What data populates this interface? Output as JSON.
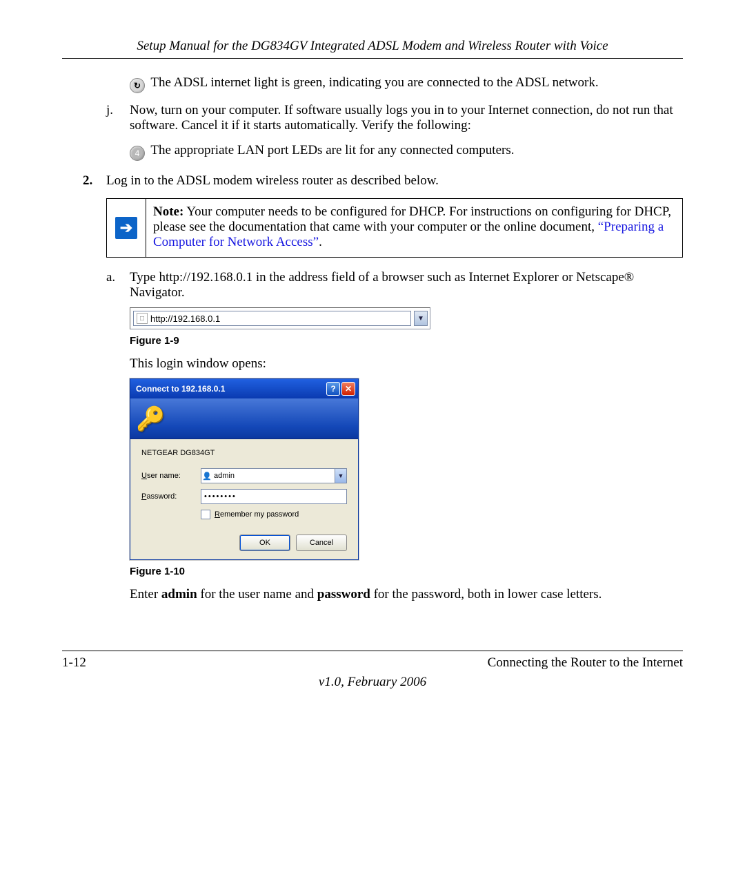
{
  "header": {
    "title": "Setup Manual for the DG834GV Integrated ADSL Modem and Wireless Router with Voice"
  },
  "body": {
    "i_line": "The ADSL internet light is green, indicating you are connected to the ADSL network.",
    "j_marker": "j.",
    "j_text": "Now, turn on your computer. If software usually logs you in to your Internet connection, do not run that software. Cancel it if it starts automatically. Verify the following:",
    "lan_badge": "4",
    "lan_text": "The appropriate LAN port LEDs are lit for any connected computers.",
    "step2_marker": "2.",
    "step2_text": "Log in to the ADSL modem wireless router as described below.",
    "note_label": "Note:",
    "note_text": " Your computer needs to be configured for DHCP. For instructions on configuring for DHCP, please see the documentation that came with your computer or the online document, ",
    "note_link": "“Preparing a Computer for Network Access”",
    "note_period": ".",
    "a_marker": "a.",
    "a_text": "Type http://192.168.0.1 in the address field of a browser such as Internet Explorer or Netscape® Navigator.",
    "address_value": "http://192.168.0.1",
    "fig9": "Figure 1-9",
    "login_opens": "This login window opens:",
    "dialog": {
      "title": "Connect to 192.168.0.1",
      "realm": "NETGEAR DG834GT",
      "user_label_u": "U",
      "user_label_rest": "ser name:",
      "user_value": "admin",
      "pass_label_u": "P",
      "pass_label_rest": "assword:",
      "pass_value": "••••••••",
      "remember_u": "R",
      "remember_rest": "emember my password",
      "ok": "OK",
      "cancel": "Cancel"
    },
    "fig10": "Figure 1-10",
    "enter_pre": "Enter ",
    "enter_admin": "admin",
    "enter_mid": " for the user name and ",
    "enter_password": "password",
    "enter_post": " for the password, both in lower case letters."
  },
  "footer": {
    "page": "1-12",
    "section": "Connecting the Router to the Internet",
    "version": "v1.0, February 2006"
  }
}
